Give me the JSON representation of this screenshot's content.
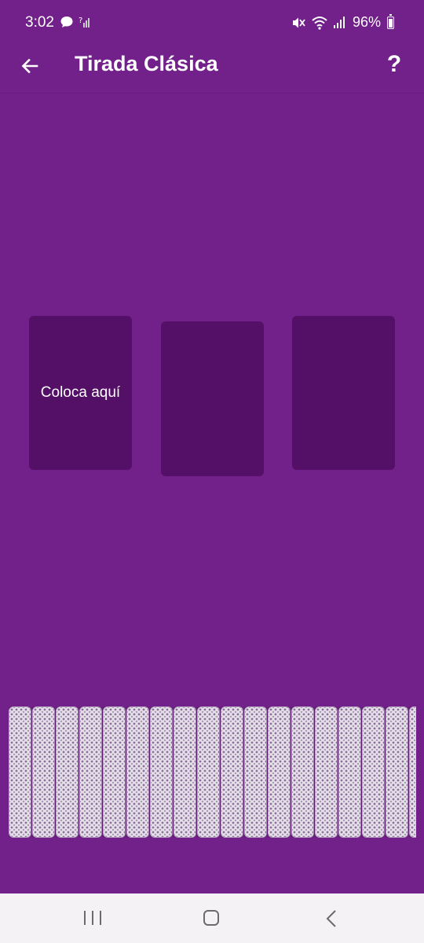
{
  "status_bar": {
    "time": "3:02",
    "battery": "96%",
    "icons": [
      "chat-bubble-icon",
      "no-signal-icon",
      "mute-icon",
      "wifi-icon",
      "signal-icon",
      "battery-icon"
    ]
  },
  "app_bar": {
    "title": "Tirada Clásica",
    "back_icon": "arrow-left-icon",
    "help_label": "?"
  },
  "slots": [
    {
      "label": "Coloca aquí"
    },
    {
      "label": ""
    },
    {
      "label": ""
    }
  ],
  "deck": {
    "card_count": 18
  },
  "nav_bar": {
    "icons": [
      "recents-icon",
      "home-icon",
      "back-icon"
    ]
  },
  "colors": {
    "background": "#72218a",
    "slot": "#540f66",
    "nav_bar": "#f4f2f4"
  }
}
